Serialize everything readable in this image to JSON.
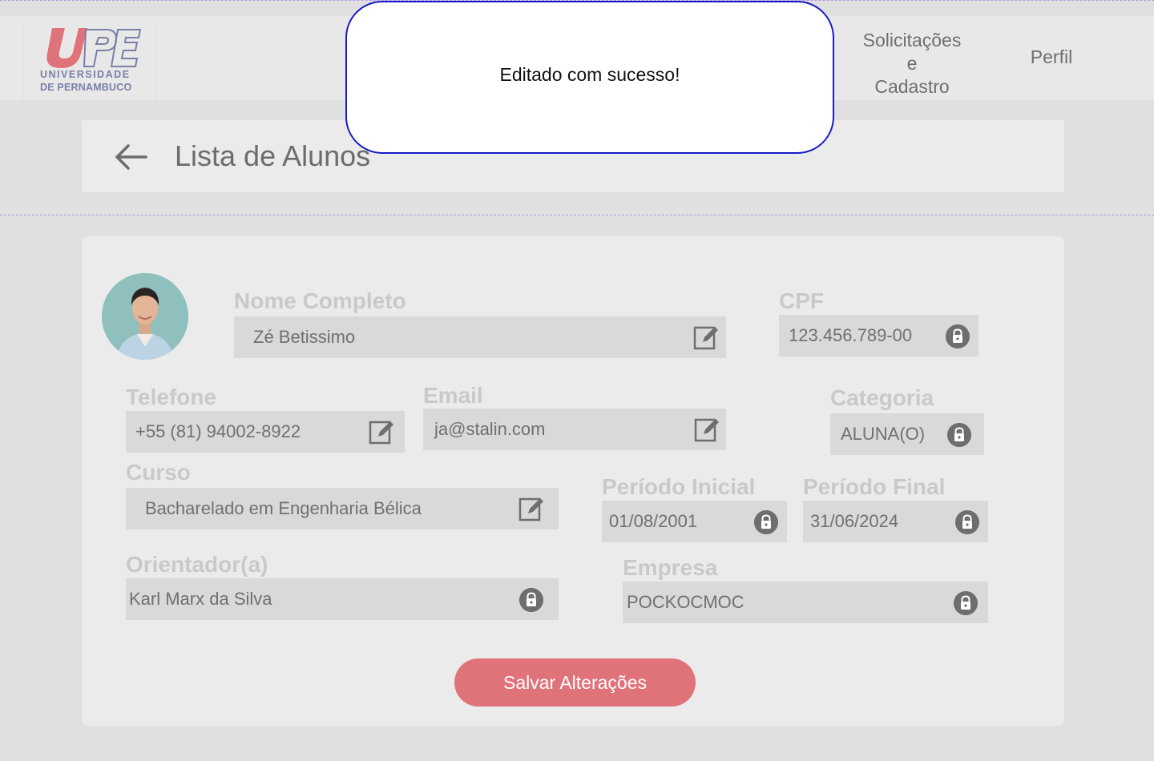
{
  "app": {
    "logo": {
      "line1": "UNIVERSIDADE",
      "line2": "DE PERNAMBUCO",
      "mark": "UPE",
      "colors": {
        "red": "#e0737a",
        "blue": "#7b7fa8"
      }
    }
  },
  "nav": {
    "solicitacoes": {
      "line1": "Solicitações",
      "line2": "e",
      "line3": "Cadastro"
    },
    "perfil": "Perfil"
  },
  "header": {
    "back_icon": "arrow-left-icon",
    "title": "Lista de Alunos"
  },
  "toast": {
    "message": "Editado com sucesso!",
    "border_color": "#1818c8"
  },
  "form": {
    "nome": {
      "label": "Nome Completo",
      "value": "Zé Betissimo",
      "icon": "edit-icon"
    },
    "cpf": {
      "label": "CPF",
      "value": "123.456.789-00",
      "icon": "lock-icon"
    },
    "telefone": {
      "label": "Telefone",
      "value": "+55 (81) 94002-8922",
      "icon": "edit-icon"
    },
    "email": {
      "label": "Email",
      "value": "ja@stalin.com",
      "icon": "edit-icon"
    },
    "categoria": {
      "label": "Categoria",
      "value": "ALUNA(O)",
      "icon": "lock-icon"
    },
    "curso": {
      "label": "Curso",
      "value": "Bacharelado em Engenharia Bélica",
      "icon": "edit-icon"
    },
    "periodo_inicial": {
      "label": "Período Inicial",
      "value": "01/08/2001",
      "icon": "lock-icon"
    },
    "periodo_final": {
      "label": "Período Final",
      "value": "31/06/2024",
      "icon": "lock-icon"
    },
    "orientador": {
      "label": "Orientador(a)",
      "value": "Karl Marx da Silva",
      "icon": "lock-icon"
    },
    "empresa": {
      "label": "Empresa",
      "value": "POCKOCMOC",
      "icon": "lock-icon"
    }
  },
  "actions": {
    "save_label": "Salvar Alterações",
    "save_color": "#e0737a"
  }
}
